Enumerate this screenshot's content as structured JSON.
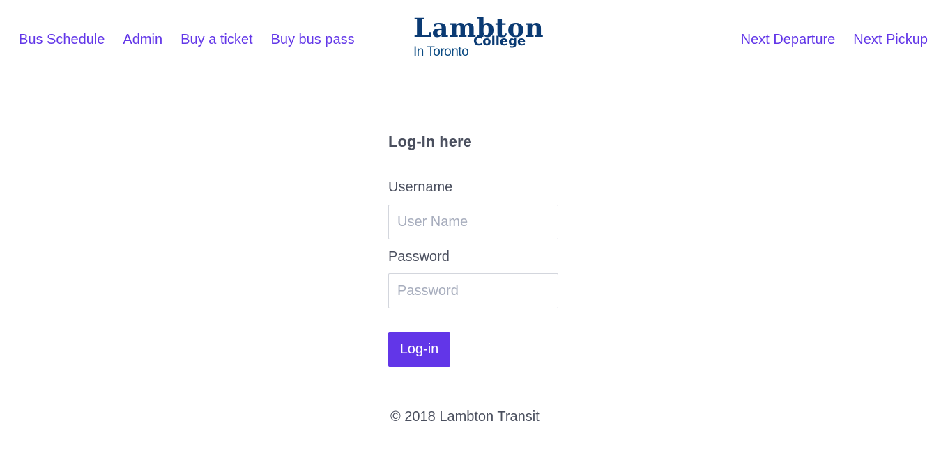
{
  "nav": {
    "left_links": [
      "Bus Schedule",
      "Admin",
      "Buy a ticket",
      "Buy bus pass"
    ],
    "right_links": [
      "Next Departure",
      "Next Pickup"
    ],
    "link_color": "#6236e8"
  },
  "logo": {
    "main": "Lambton",
    "sub": "College",
    "city": "In Toronto",
    "color": "#0a3a73"
  },
  "form": {
    "title": "Log-In here",
    "username_label": "Username",
    "username_placeholder": "User Name",
    "username_value": "",
    "password_label": "Password",
    "password_placeholder": "Password",
    "password_value": "",
    "submit_label": "Log-in",
    "button_color": "#6236e8"
  },
  "footer": {
    "text": "© 2018 Lambton Transit"
  }
}
